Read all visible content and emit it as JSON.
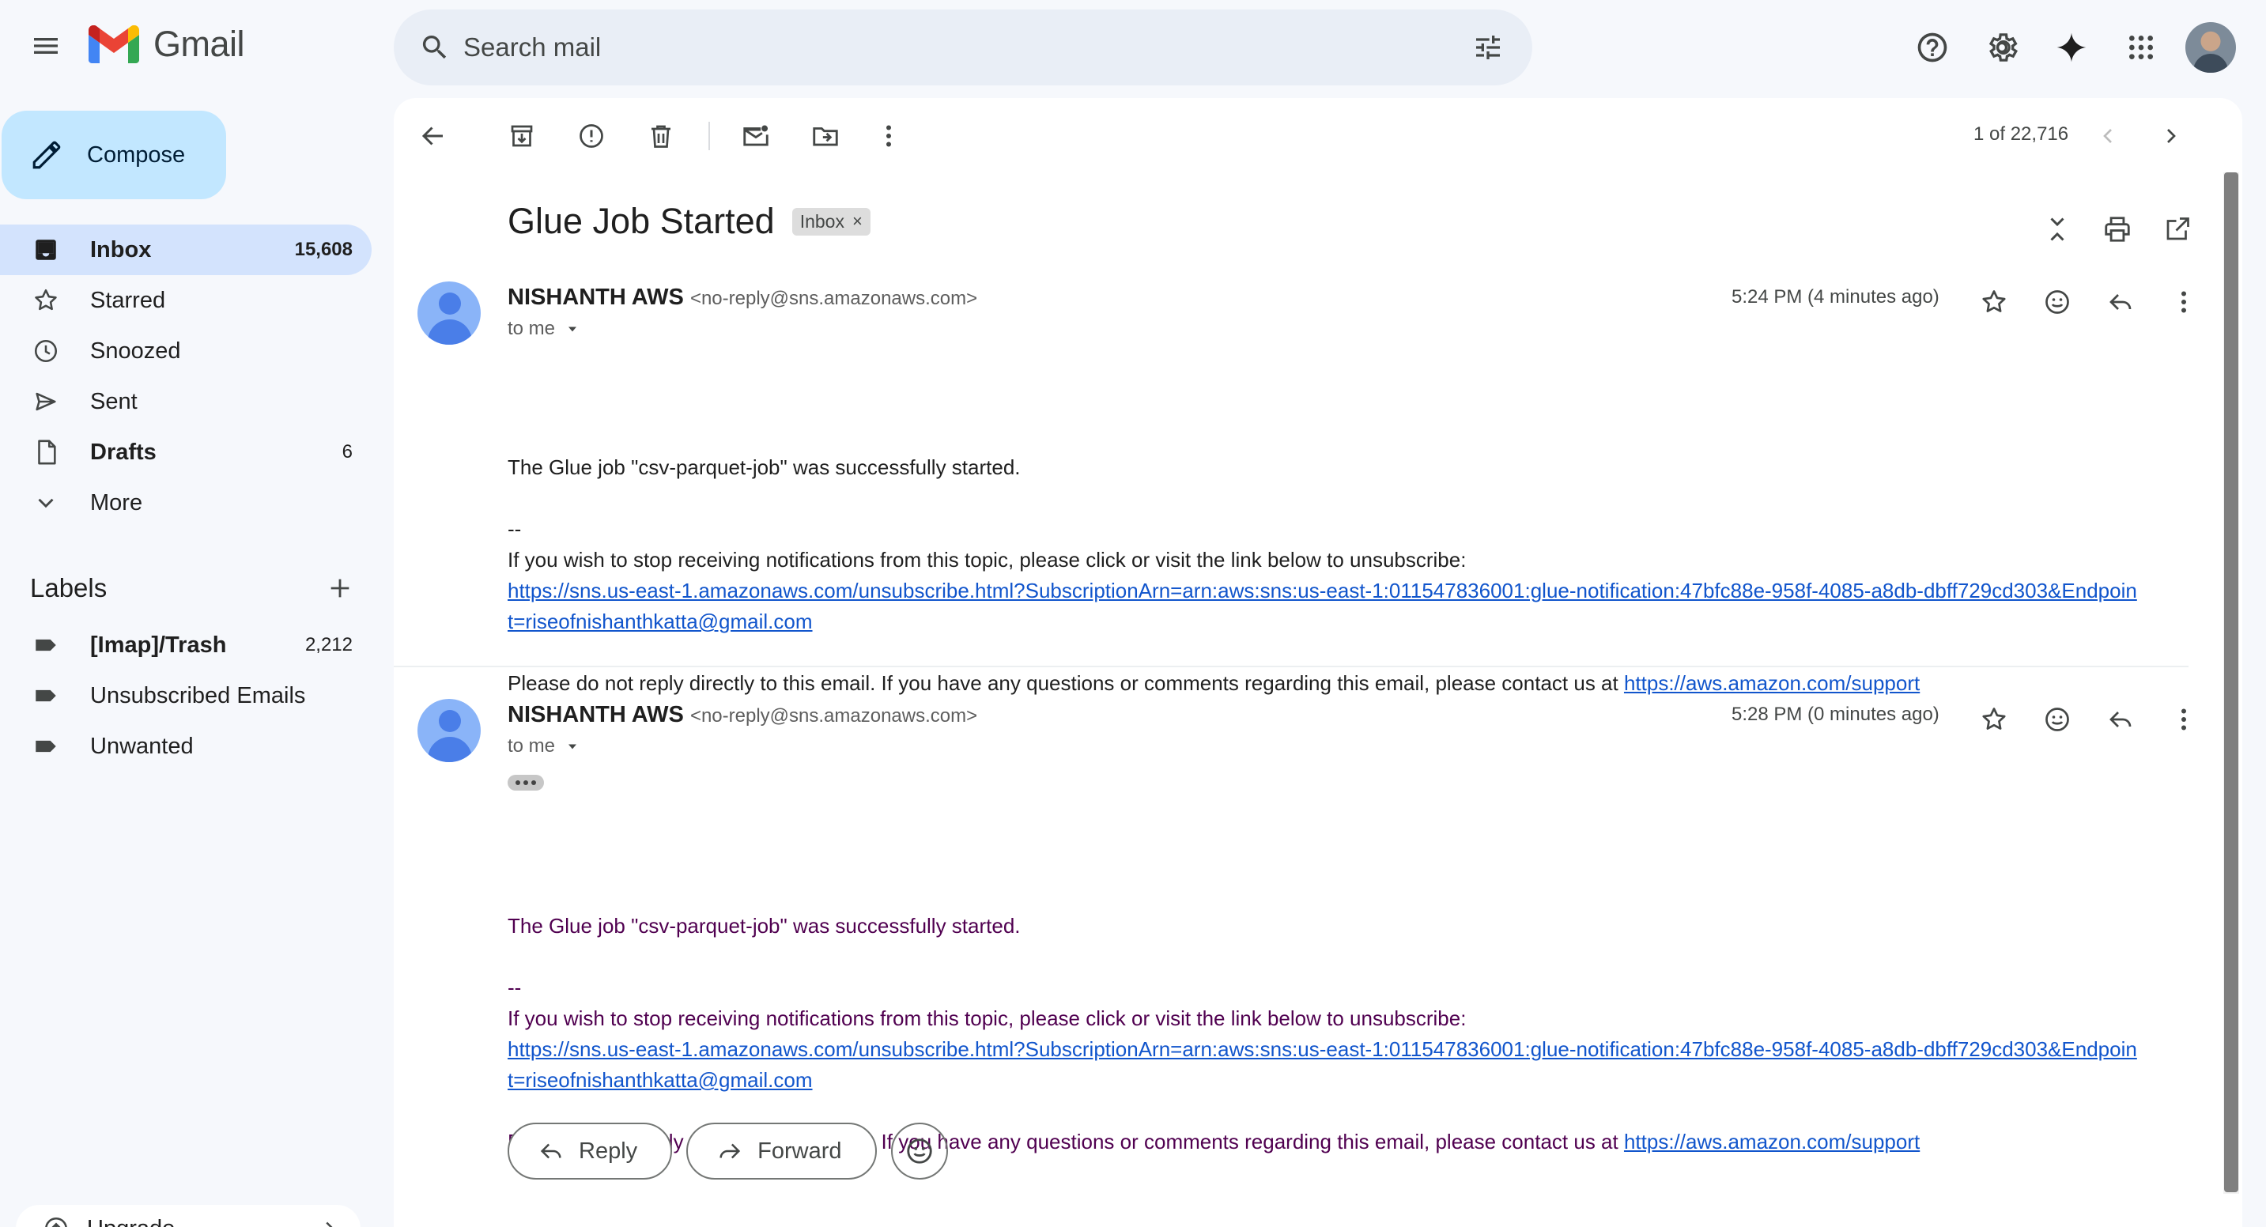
{
  "app": {
    "name": "Gmail"
  },
  "search": {
    "placeholder": "Search mail"
  },
  "sidebar": {
    "compose_label": "Compose",
    "items": [
      {
        "label": "Inbox",
        "count": "15,608",
        "icon": "inbox-icon"
      },
      {
        "label": "Starred",
        "count": "",
        "icon": "star-icon"
      },
      {
        "label": "Snoozed",
        "count": "",
        "icon": "clock-icon"
      },
      {
        "label": "Sent",
        "count": "",
        "icon": "send-icon"
      },
      {
        "label": "Drafts",
        "count": "6",
        "icon": "draft-icon"
      },
      {
        "label": "More",
        "count": "",
        "icon": "chevron-down-icon"
      }
    ],
    "labels_title": "Labels",
    "labels": [
      {
        "label": "[Imap]/Trash",
        "count": "2,212"
      },
      {
        "label": "Unsubscribed Emails",
        "count": ""
      },
      {
        "label": "Unwanted",
        "count": ""
      }
    ],
    "upgrade_label": "Upgrade"
  },
  "toolbar": {
    "page_count": "1 of 22,716"
  },
  "thread": {
    "subject": "Glue Job Started",
    "label_chip": "Inbox",
    "label_chip_close": "×",
    "messages": [
      {
        "sender_name": "NISHANTH AWS",
        "sender_email": "<no-reply@sns.amazonaws.com>",
        "to": "to me",
        "time": "5:24 PM (4 minutes ago)",
        "line1": "The Glue job \"csv-parquet-job\" was successfully started.",
        "sig": "--",
        "line2": "If you wish to stop receiving notifications from this topic, please click or visit the link below to unsubscribe:",
        "link_a": "https://sns.us-east-1.amazonaws.com/unsubscribe.html?SubscriptionArn=arn:aws:sns:us-east-1:011547836001:glue-notification:47bfc88e-958f-4085-a8db-dbff729cd303&Endpoin",
        "link_b": "t=riseofnishanthkatta@gmail.com",
        "line3": "Please do not reply directly to this email. If you have any questions or comments regarding this email, please contact us at ",
        "support_link": "https://aws.amazon.com/support"
      },
      {
        "sender_name": "NISHANTH AWS",
        "sender_email": "<no-reply@sns.amazonaws.com>",
        "to": "to me",
        "time": "5:28 PM (0 minutes ago)",
        "line1": "The Glue job \"csv-parquet-job\" was successfully started.",
        "sig": "--",
        "line2": "If you wish to stop receiving notifications from this topic, please click or visit the link below to unsubscribe:",
        "link_a": "https://sns.us-east-1.amazonaws.com/unsubscribe.html?SubscriptionArn=arn:aws:sns:us-east-1:011547836001:glue-notification:47bfc88e-958f-4085-a8db-dbff729cd303&Endpoin",
        "link_b": "t=riseofnishanthkatta@gmail.com",
        "line3": "Please do not reply directly to this email. If you have any questions or comments regarding this email, please contact us at ",
        "support_link": "https://aws.amazon.com/support"
      }
    ]
  },
  "reply_bar": {
    "reply_label": "Reply",
    "forward_label": "Forward"
  },
  "colors": {
    "accent": "#0b57d0",
    "active_nav": "#d3e3fd",
    "compose": "#c2e7ff",
    "background": "#f6f8fc",
    "quoted_text": "#500050"
  }
}
